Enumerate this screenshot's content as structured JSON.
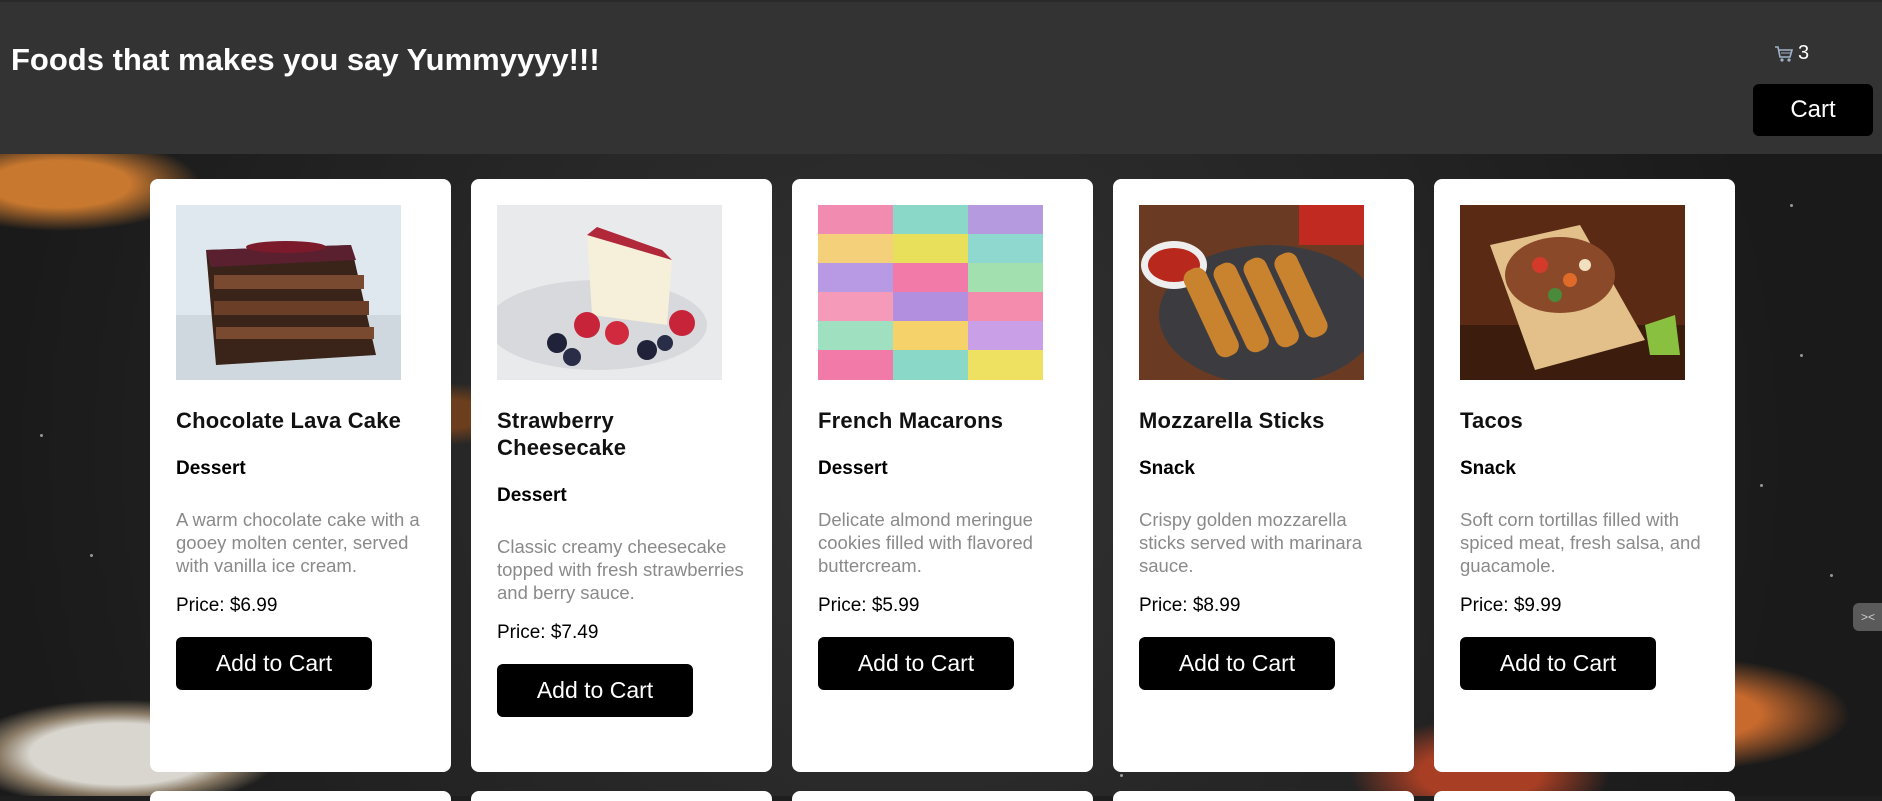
{
  "header": {
    "title": "Foods that makes you say Yummyyyy!!!",
    "cart_count": "3",
    "cart_icon": "shopping-cart-icon",
    "cart_button_label": "Cart"
  },
  "products": [
    {
      "name": "Chocolate Lava Cake",
      "category": "Dessert",
      "description": "A warm chocolate cake with a gooey molten center, served with vanilla ice cream.",
      "price": "Price: $6.99",
      "button": "Add to Cart",
      "image": "chocolate-lava-cake-photo"
    },
    {
      "name": "Strawberry Cheesecake",
      "category": "Dessert",
      "description": "Classic creamy cheesecake topped with fresh strawberries and berry sauce.",
      "price": "Price: $7.49",
      "button": "Add to Cart",
      "image": "strawberry-cheesecake-photo"
    },
    {
      "name": "French Macarons",
      "category": "Dessert",
      "description": "Delicate almond meringue cookies filled with flavored buttercream.",
      "price": "Price: $5.99",
      "button": "Add to Cart",
      "image": "french-macarons-photo"
    },
    {
      "name": "Mozzarella Sticks",
      "category": "Snack",
      "description": "Crispy golden mozzarella sticks served with marinara sauce.",
      "price": "Price: $8.99",
      "button": "Add to Cart",
      "image": "mozzarella-sticks-photo"
    },
    {
      "name": "Tacos",
      "category": "Snack",
      "description": "Soft corn tortillas filled with spiced meat, fresh salsa, and guacamole.",
      "price": "Price: $9.99",
      "button": "Add to Cart",
      "image": "tacos-photo"
    }
  ],
  "colors": {
    "header_bg": "#333333",
    "button_bg": "#000000",
    "card_bg": "#ffffff",
    "description_text": "#8a8a8a"
  }
}
